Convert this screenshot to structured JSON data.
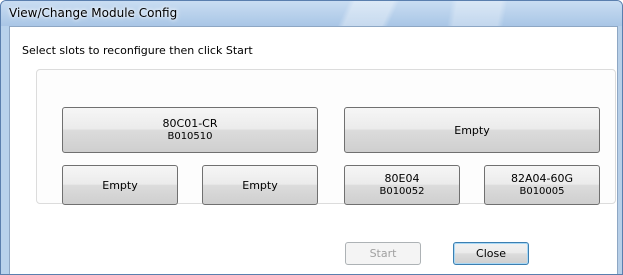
{
  "window": {
    "title": "View/Change Module Config"
  },
  "instruction": "Select slots to reconfigure then click Start",
  "slots": [
    {
      "name": "80C01-CR",
      "serial": "B010510"
    },
    {
      "name": "Empty",
      "serial": ""
    },
    {
      "name": "Empty",
      "serial": ""
    },
    {
      "name": "Empty",
      "serial": ""
    },
    {
      "name": "80E04",
      "serial": "B010052"
    },
    {
      "name": "82A04-60G",
      "serial": "B010005"
    }
  ],
  "buttons": {
    "start": "Start",
    "close": "Close",
    "start_enabled": false
  }
}
